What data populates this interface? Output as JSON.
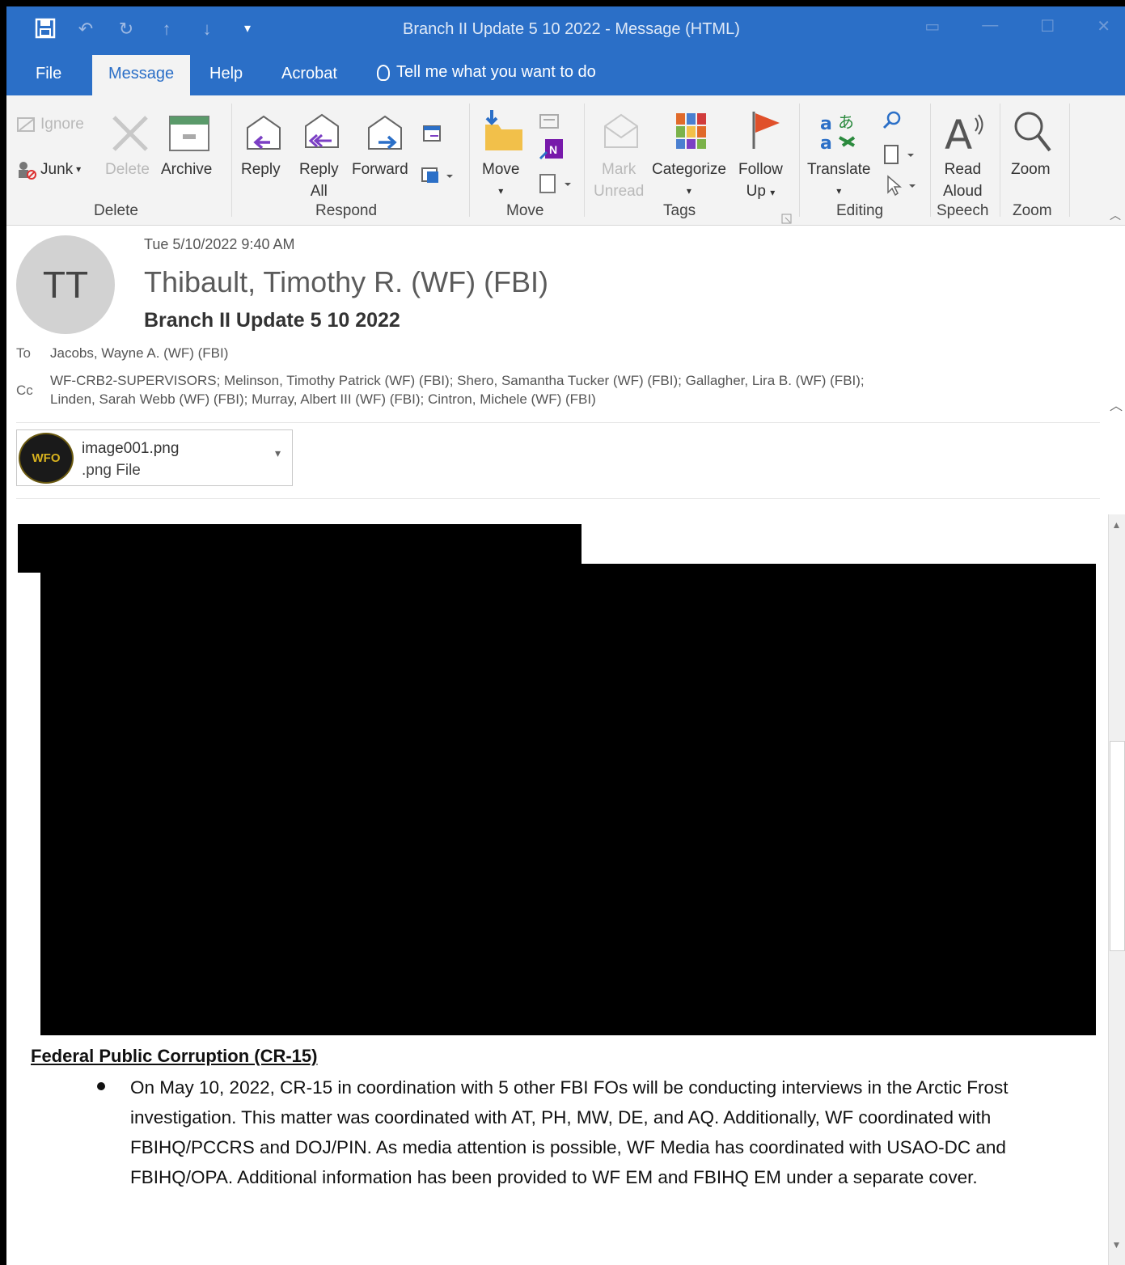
{
  "window": {
    "title": "Branch II Update 5 10 2022  -  Message (HTML)",
    "quick_access": [
      "save-icon",
      "undo-icon",
      "redo-icon",
      "up-icon",
      "down-icon",
      "customize-icon"
    ]
  },
  "menu": {
    "tabs": [
      "File",
      "Message",
      "Help",
      "Acrobat"
    ],
    "active_tab": "Message",
    "tell_me": "Tell me what you want to do"
  },
  "ribbon": {
    "delete": {
      "ignore": "Ignore",
      "junk": "Junk",
      "delete": "Delete",
      "archive": "Archive",
      "group": "Delete"
    },
    "respond": {
      "reply": "Reply",
      "reply_all_1": "Reply",
      "reply_all_2": "All",
      "forward": "Forward",
      "group": "Respond"
    },
    "move": {
      "move": "Move",
      "group": "Move"
    },
    "tags": {
      "mark_1": "Mark",
      "mark_2": "Unread",
      "categorize": "Categorize",
      "follow_1": "Follow",
      "follow_2": "Up",
      "group": "Tags"
    },
    "editing": {
      "translate": "Translate",
      "group": "Editing"
    },
    "speech": {
      "read_1": "Read",
      "read_2": "Aloud",
      "group": "Speech"
    },
    "zoom": {
      "zoom": "Zoom",
      "group": "Zoom"
    }
  },
  "message": {
    "avatar_initials": "TT",
    "date": "Tue 5/10/2022 9:40 AM",
    "sender": "Thibault, Timothy R. (WF) (FBI)",
    "subject": "Branch II Update 5 10 2022",
    "to_label": "To",
    "to": "Jacobs, Wayne A. (WF) (FBI)",
    "cc_label": "Cc",
    "cc_line1": "WF-CRB2-SUPERVISORS; Melinson, Timothy Patrick (WF) (FBI); Shero, Samantha Tucker (WF) (FBI); Gallagher, Lira B. (WF) (FBI);",
    "cc_line2": "Linden, Sarah Webb (WF) (FBI); Murray, Albert III (WF) (FBI); Cintron, Michele (WF) (FBI)"
  },
  "attachment": {
    "name": "image001.png",
    "type": ".png File",
    "logo_text": "WFO"
  },
  "body": {
    "section_title": "Federal Public Corruption (CR-15)",
    "bullet": "On May 10, 2022, CR-15 in coordination with 5 other FBI FOs will be conducting interviews in the Arctic Frost investigation. This matter was coordinated with AT, PH, MW, DE, and AQ.  Additionally, WF coordinated with FBIHQ/PCCRS and DOJ/PIN.  As media attention is possible, WF Media has coordinated with USAO-DC and FBIHQ/OPA.  Additional information has been provided to WF EM and FBIHQ EM under a separate cover."
  },
  "colors": {
    "accent": "#2b6fc7",
    "ribbon_bg": "#f3f3f3",
    "redaction": "#000000"
  }
}
